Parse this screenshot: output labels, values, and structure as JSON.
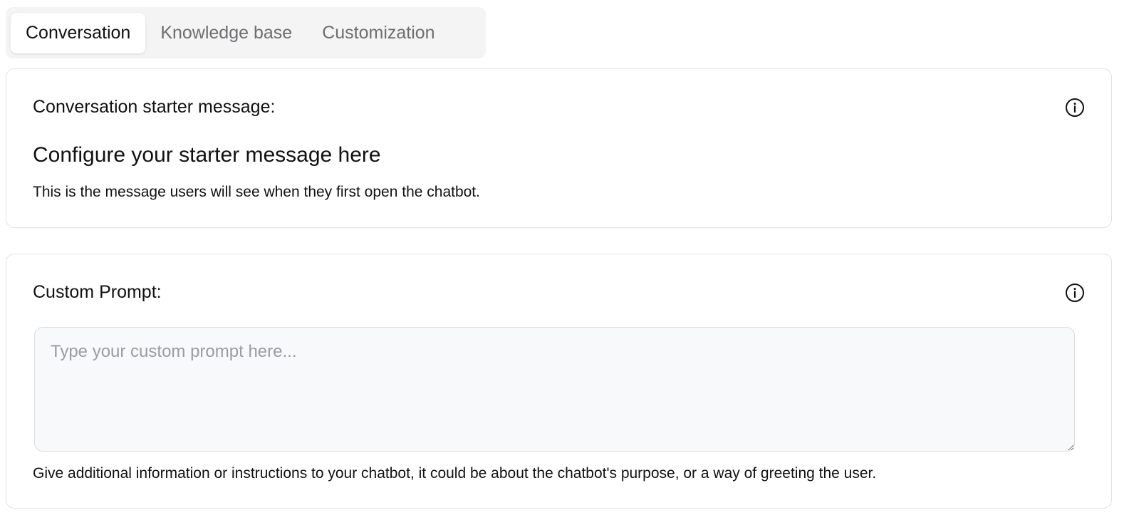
{
  "tabs": [
    {
      "label": "Conversation",
      "active": true
    },
    {
      "label": "Knowledge base",
      "active": false
    },
    {
      "label": "Customization",
      "active": false
    }
  ],
  "starter": {
    "label": "Conversation starter message:",
    "heading": "Configure your starter message here",
    "description": "This is the message users will see when they first open the chatbot.",
    "icon": "info-icon"
  },
  "custom_prompt": {
    "label": "Custom Prompt:",
    "value": "",
    "placeholder": "Type your custom prompt here...",
    "help": "Give additional information or instructions to your chatbot, it could be about the chatbot's purpose, or a way of greeting the user.",
    "icon": "info-icon"
  },
  "colors": {
    "tab_bar_bg": "#f4f4f5",
    "active_tab_bg": "#ffffff",
    "inactive_tab_text": "#6e6e72",
    "card_border": "#e2e2e5",
    "textarea_bg": "#f8f9fa"
  }
}
